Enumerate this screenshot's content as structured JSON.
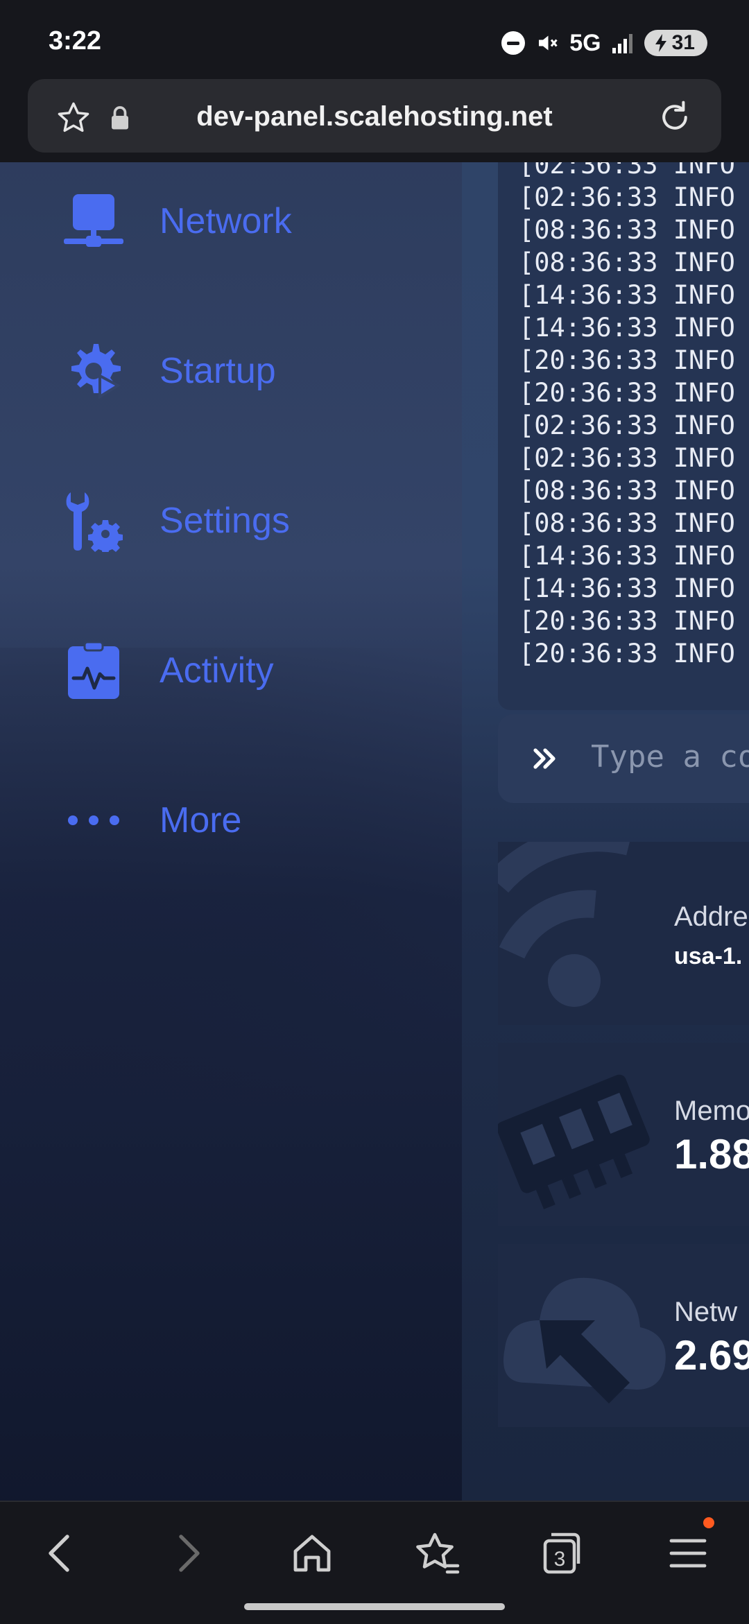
{
  "status_bar": {
    "time": "3:22",
    "network": "5G",
    "battery": "31"
  },
  "browser": {
    "url": "dev-panel.scalehosting.net"
  },
  "sidebar": {
    "items": [
      {
        "label": "Network",
        "icon": "network-icon"
      },
      {
        "label": "Startup",
        "icon": "startup-gear-icon"
      },
      {
        "label": "Settings",
        "icon": "settings-wrench-icon"
      },
      {
        "label": "Activity",
        "icon": "activity-icon"
      },
      {
        "label": "More",
        "icon": "more-dots-icon"
      }
    ]
  },
  "console": {
    "lines": [
      "[02:36:33 INFO",
      "[02:36:33 INFO",
      "[08:36:33 INFO",
      "[08:36:33 INFO",
      "[14:36:33 INFO",
      "[14:36:33 INFO",
      "[20:36:33 INFO",
      "[20:36:33 INFO",
      "[02:36:33 INFO",
      "[02:36:33 INFO",
      "[08:36:33 INFO",
      "[08:36:33 INFO",
      "[14:36:33 INFO",
      "[14:36:33 INFO",
      "[20:36:33 INFO",
      "[20:36:33 INFO"
    ],
    "command_placeholder": "Type a co"
  },
  "stats": {
    "address": {
      "label": "Addre",
      "value": "usa-1."
    },
    "memory": {
      "label": "Memo",
      "value": "1.88"
    },
    "network": {
      "label": "Netw",
      "value": "2.69"
    }
  },
  "bottom_nav": {
    "tabs_count": "3"
  },
  "colors": {
    "accent": "#4a6cf0",
    "notification": "#ff5a1f"
  }
}
